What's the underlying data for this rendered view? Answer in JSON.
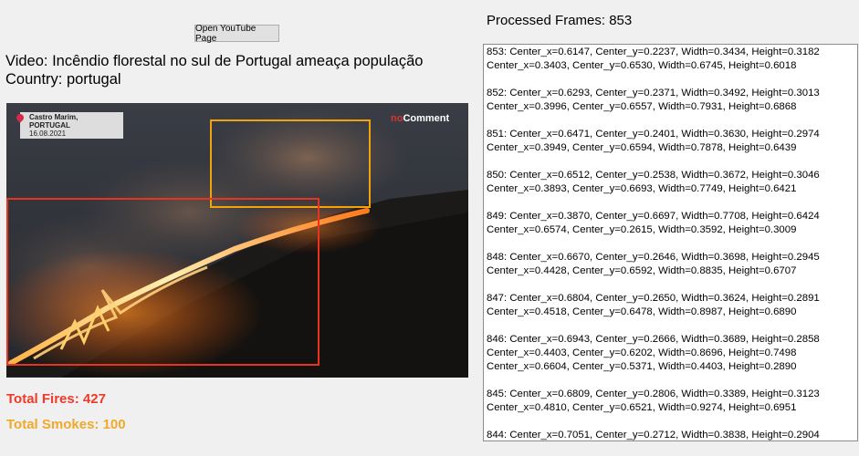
{
  "toolbar": {
    "open_youtube_label": "Open YouTube Page"
  },
  "video": {
    "title": "Video: Incêndio florestal no sul de Portugal ameaça população",
    "country": "Country: portugal",
    "overlay_location": "Castro Marim, PORTUGAL",
    "overlay_date": "16.08.2021",
    "logo_prefix": "no",
    "logo_text": "Comment",
    "detection_colors": {
      "fire": "#e8331f",
      "smoke": "#f0a30a"
    }
  },
  "totals": {
    "fires": "Total Fires: 427",
    "smokes": "Total Smokes: 100",
    "fires_color": "#ef3a2a",
    "smokes_color": "#f0a92a"
  },
  "processed_frames": "Processed Frames: 853",
  "frames": [
    {
      "lines": [
        "853: Center_x=0.6147, Center_y=0.2237, Width=0.3434, Height=0.3182",
        "Center_x=0.3403, Center_y=0.6530, Width=0.6745, Height=0.6018"
      ]
    },
    {
      "lines": [
        "852: Center_x=0.6293, Center_y=0.2371, Width=0.3492, Height=0.3013",
        "Center_x=0.3996, Center_y=0.6557, Width=0.7931, Height=0.6868"
      ]
    },
    {
      "lines": [
        "851: Center_x=0.6471, Center_y=0.2401, Width=0.3630, Height=0.2974",
        "Center_x=0.3949, Center_y=0.6594, Width=0.7878, Height=0.6439"
      ]
    },
    {
      "lines": [
        "850: Center_x=0.6512, Center_y=0.2538, Width=0.3672, Height=0.3046",
        "Center_x=0.3893, Center_y=0.6693, Width=0.7749, Height=0.6421"
      ]
    },
    {
      "lines": [
        "849: Center_x=0.3870, Center_y=0.6697, Width=0.7708, Height=0.6424",
        "Center_x=0.6574, Center_y=0.2615, Width=0.3592, Height=0.3009"
      ]
    },
    {
      "lines": [
        "848: Center_x=0.6670, Center_y=0.2646, Width=0.3698, Height=0.2945",
        "Center_x=0.4428, Center_y=0.6592, Width=0.8835, Height=0.6707"
      ]
    },
    {
      "lines": [
        "847: Center_x=0.6804, Center_y=0.2650, Width=0.3624, Height=0.2891",
        "Center_x=0.4518, Center_y=0.6478, Width=0.8987, Height=0.6890"
      ]
    },
    {
      "lines": [
        "846: Center_x=0.6943, Center_y=0.2666, Width=0.3689, Height=0.2858",
        "Center_x=0.4403, Center_y=0.6202, Width=0.8696, Height=0.7498",
        "Center_x=0.6604, Center_y=0.5371, Width=0.4403, Height=0.2890"
      ]
    },
    {
      "lines": [
        "845: Center_x=0.6809, Center_y=0.2806, Width=0.3389, Height=0.3123",
        "Center_x=0.4810, Center_y=0.6521, Width=0.9274, Height=0.6951"
      ]
    },
    {
      "lines": [
        "844: Center_x=0.7051, Center_y=0.2712, Width=0.3838, Height=0.2904"
      ]
    }
  ]
}
